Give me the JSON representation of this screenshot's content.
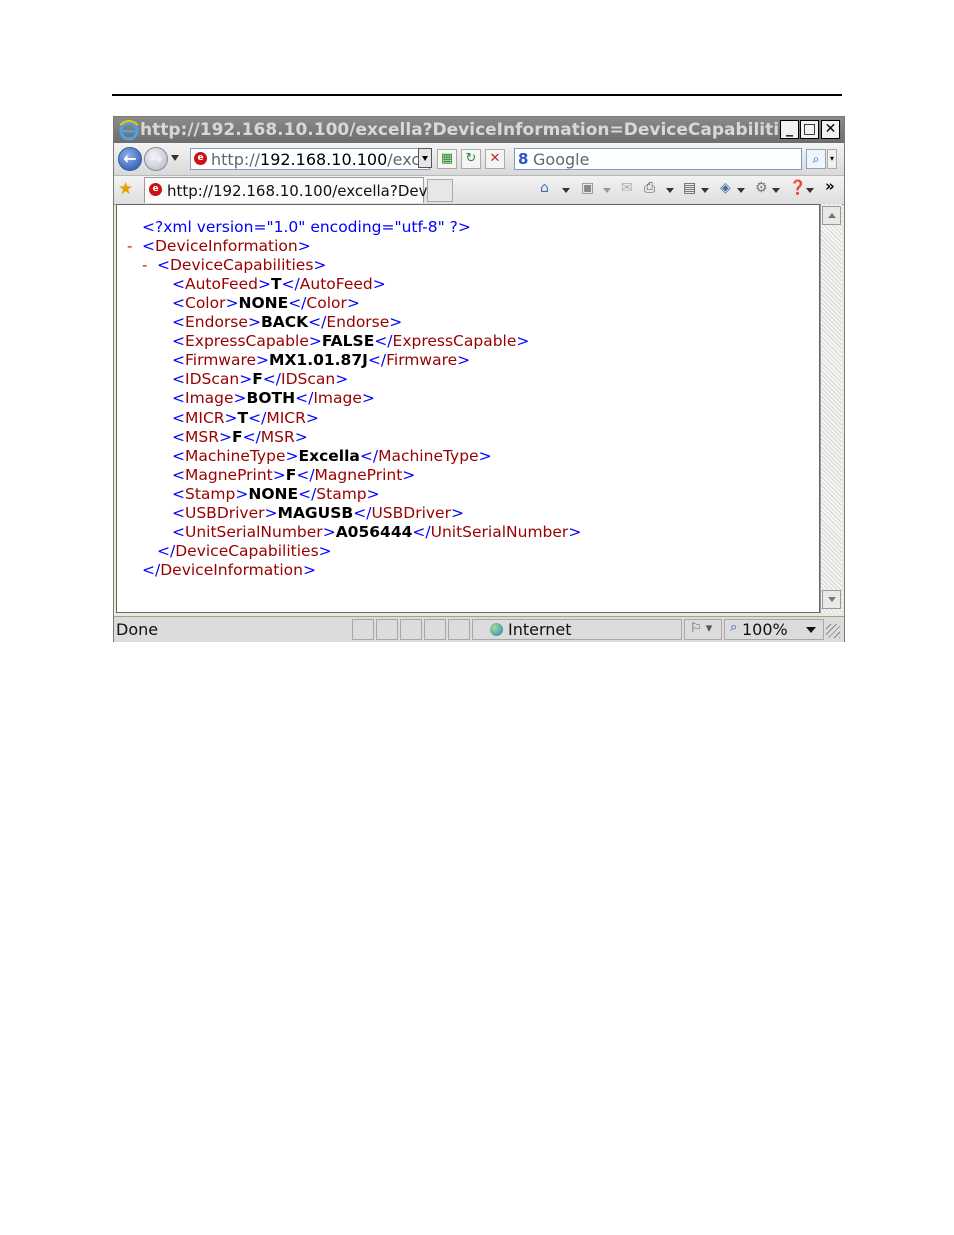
{
  "window": {
    "title": "http://192.168.10.100/excella?DeviceInformation=DeviceCapabiliti...",
    "minimize_icon": "minimize-icon",
    "maximize_icon": "maximize-icon",
    "close_icon": "close-icon"
  },
  "address_bar": {
    "prefix": "http://",
    "host": "192.168.10.100",
    "suffix": "/exc"
  },
  "search": {
    "engine_glyph": "8",
    "placeholder": "Google"
  },
  "tab": {
    "label": "http://192.168.10.100/excella?Devi..."
  },
  "xml": {
    "declaration": "<?xml version=\"1.0\" encoding=\"utf-8\" ?>",
    "root_open": "<DeviceInformation>",
    "root_close": "</DeviceInformation>",
    "group_open": "<DeviceCapabilities>",
    "group_close": "</DeviceCapabilities>",
    "collapse_glyph": "-",
    "fields": [
      {
        "tag": "AutoFeed",
        "value": "T"
      },
      {
        "tag": "Color",
        "value": "NONE"
      },
      {
        "tag": "Endorse",
        "value": "BACK"
      },
      {
        "tag": "ExpressCapable",
        "value": "FALSE"
      },
      {
        "tag": "Firmware",
        "value": "MX1.01.87J"
      },
      {
        "tag": "IDScan",
        "value": "F"
      },
      {
        "tag": "Image",
        "value": "BOTH"
      },
      {
        "tag": "MICR",
        "value": "T"
      },
      {
        "tag": "MSR",
        "value": "F"
      },
      {
        "tag": "MachineType",
        "value": "Excella"
      },
      {
        "tag": "MagnePrint",
        "value": "F"
      },
      {
        "tag": "Stamp",
        "value": "NONE"
      },
      {
        "tag": "USBDriver",
        "value": "MAGUSB"
      },
      {
        "tag": "UnitSerialNumber",
        "value": "A056444"
      }
    ]
  },
  "status": {
    "text": "Done",
    "zone": "Internet",
    "zoom": "100%"
  }
}
